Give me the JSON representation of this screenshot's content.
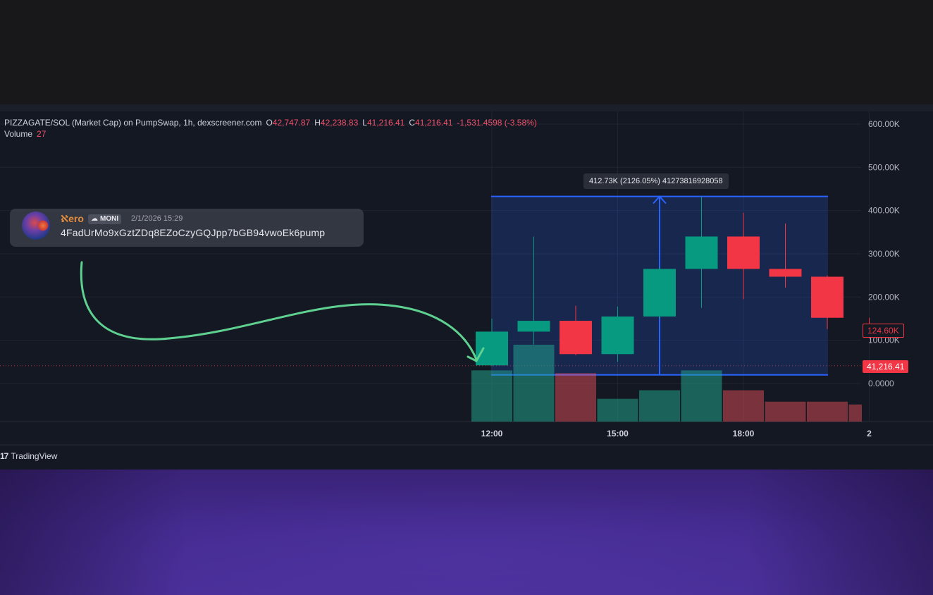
{
  "legend": {
    "pair_line": "PIZZAGATE/SOL (Market Cap) on PumpSwap, 1h, dexscreener.com",
    "open_label": "O",
    "open_value": "42,747.87",
    "high_label": "H",
    "high_value": "42,238.83",
    "low_label": "L",
    "low_value": "41,216.41",
    "close_label": "C",
    "close_value": "41,216.41",
    "change_value": "-1,531.4598 (-3.58%)",
    "volume_label": "Volume",
    "volume_value": "27"
  },
  "message": {
    "author": "ℵero",
    "badge": "MONI",
    "timestamp": "2/1/2026 15:29",
    "text": "4FadUrMo9xGztZDq8EZoCzyGQJpp7bGB94vwoEk6pump"
  },
  "measure_tool": {
    "label": "412.73K (2126.05%) 41273816928058"
  },
  "price_tags": {
    "last_candle": "124.60K",
    "current_price": "41,216.41"
  },
  "branding": {
    "logo_mark": "17",
    "logo_text": "TradingView"
  },
  "colors": {
    "up": "#089981",
    "down": "#f23645",
    "measure": "#2962ff",
    "arrow": "#5ed190"
  },
  "chart_data": {
    "type": "candlestick",
    "y_axis_ticks": [
      "600.00K",
      "500.00K",
      "400.00K",
      "300.00K",
      "200.00K",
      "100.00K",
      "0.0000"
    ],
    "y_tick_values": [
      600000,
      500000,
      400000,
      300000,
      200000,
      100000,
      0
    ],
    "ylim": [
      -20000,
      640000
    ],
    "x_axis_ticks": [
      {
        "label": "12:00",
        "hour": 12
      },
      {
        "label": "15:00",
        "hour": 15
      },
      {
        "label": "18:00",
        "hour": 18
      },
      {
        "label": "2",
        "hour": 21
      }
    ],
    "candles": [
      {
        "hour": 12,
        "open": 42000,
        "high": 150000,
        "low": 40000,
        "close": 120000,
        "volume": 18
      },
      {
        "hour": 13,
        "open": 120000,
        "high": 340000,
        "low": 90000,
        "close": 145000,
        "volume": 27
      },
      {
        "hour": 14,
        "open": 145000,
        "high": 180000,
        "low": 65000,
        "close": 68000,
        "volume": 17
      },
      {
        "hour": 15,
        "open": 68000,
        "high": 178000,
        "low": 50000,
        "close": 155000,
        "volume": 8
      },
      {
        "hour": 16,
        "open": 155000,
        "high": 270000,
        "low": 150000,
        "close": 265000,
        "volume": 11
      },
      {
        "hour": 17,
        "open": 265000,
        "high": 432000,
        "low": 175000,
        "close": 340000,
        "volume": 18
      },
      {
        "hour": 18,
        "open": 340000,
        "high": 395000,
        "low": 195000,
        "close": 265000,
        "volume": 11
      },
      {
        "hour": 19,
        "open": 265000,
        "high": 370000,
        "low": 222000,
        "close": 247000,
        "volume": 7
      },
      {
        "hour": 20,
        "open": 247000,
        "high": 250000,
        "low": 126000,
        "close": 152000,
        "volume": 7
      },
      {
        "hour": 21,
        "open": 152000,
        "high": 152000,
        "low": 124600,
        "close": 124600,
        "volume": 6
      }
    ],
    "current_price": 41216.41,
    "measure_range": {
      "from_hour": 12,
      "to_hour": 20,
      "low": 20000,
      "high": 432700
    }
  }
}
